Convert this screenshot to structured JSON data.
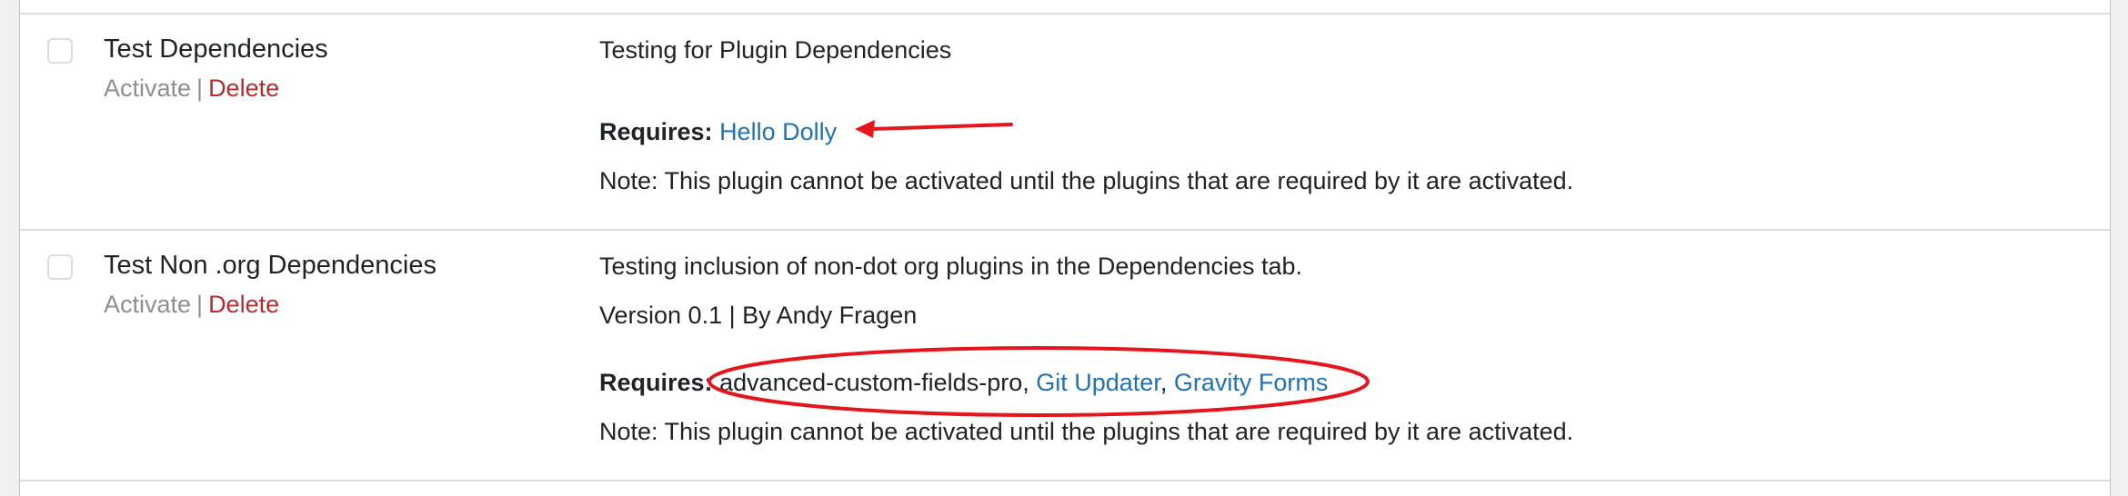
{
  "plugins": [
    {
      "name": "Test Dependencies",
      "activate_label": "Activate",
      "separator": "|",
      "delete_label": "Delete",
      "description": "Testing for Plugin Dependencies",
      "requires_label": "Requires:",
      "requires_link": "Hello Dolly",
      "note": "Note: This plugin cannot be activated until the plugins that are required by it are activated."
    },
    {
      "name": "Test Non .org Dependencies",
      "activate_label": "Activate",
      "separator": "|",
      "delete_label": "Delete",
      "description": "Testing inclusion of non-dot org plugins in the Dependencies tab.",
      "version_line": "Version 0.1 | By Andy Fragen",
      "requires_label": "Requires:",
      "requires_plain": "advanced-custom-fields-pro",
      "requires_link_1": "Git Updater",
      "requires_link_2": "Gravity Forms",
      "comma": ",",
      "note": "Note: This plugin cannot be activated until the plugins that are required by it are activated."
    }
  ],
  "colors": {
    "link": "#2271b1",
    "delete": "#b32d2e",
    "annotation": "#e5161b"
  }
}
